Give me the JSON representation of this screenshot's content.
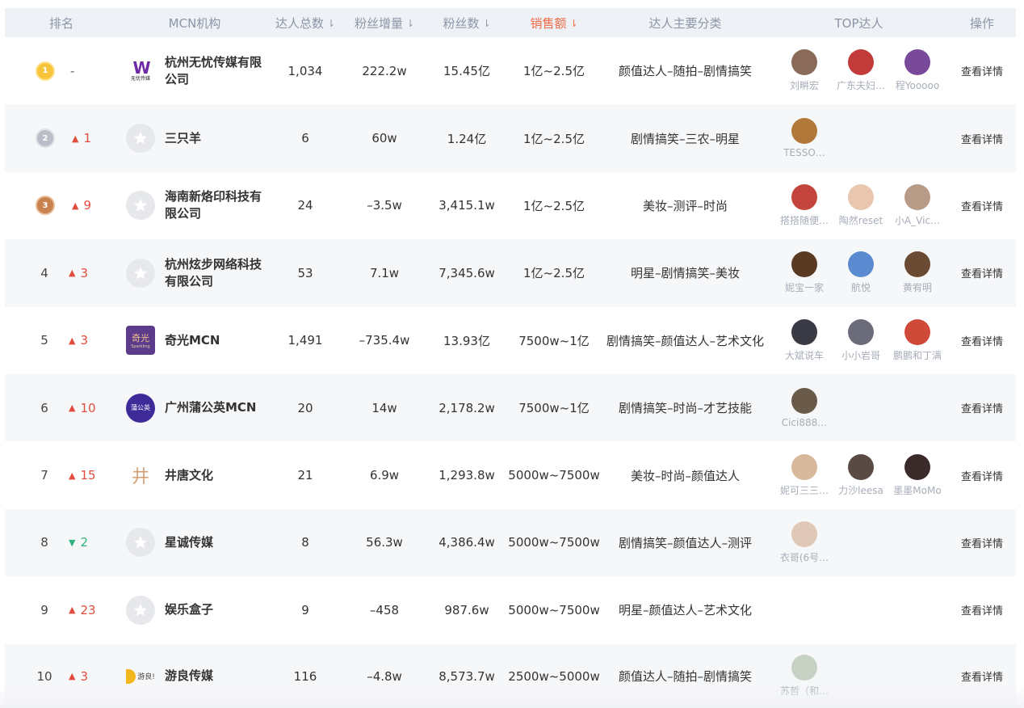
{
  "header": {
    "rank": "排名",
    "mcn": "MCN机构",
    "total": "达人总数",
    "fan_growth": "粉丝增量",
    "fans": "粉丝数",
    "sales": "销售额",
    "category": "达人主要分类",
    "top": "TOP达人",
    "op": "操作",
    "sort_icon": "sort-down-icon"
  },
  "colors": {
    "sales_header": "#ef6a45",
    "up": "#e24c3f",
    "down": "#34b27d",
    "header_bg": "#eef1f5",
    "alt_row_bg": "#f6f7f9"
  },
  "rows": [
    {
      "rank": "1",
      "change": "-",
      "dir": "none",
      "mcn": "杭州无忧传媒有限公司",
      "logo_text": "W",
      "logo_sub": "无忧传媒",
      "total": "1,034",
      "fan_growth": "222.2w",
      "fans": "15.45亿",
      "sales": "1亿~2.5亿",
      "category": "颜值达人–随拍–剧情搞笑",
      "top": [
        {
          "name": "刘畊宏",
          "color": "#8a6b5a"
        },
        {
          "name": "广东夫妇…",
          "color": "#c23a3a"
        },
        {
          "name": "程Yooooo",
          "color": "#7a4a9a"
        }
      ],
      "op": "查看详情"
    },
    {
      "rank": "2",
      "change": "1",
      "dir": "up",
      "mcn": "三只羊",
      "total": "6",
      "fan_growth": "60w",
      "fans": "1.24亿",
      "sales": "1亿~2.5亿",
      "category": "剧情搞笑–三农–明星",
      "top": [
        {
          "name": "TESSO…",
          "color": "#b0793a"
        }
      ],
      "op": "查看详情"
    },
    {
      "rank": "3",
      "change": "9",
      "dir": "up",
      "mcn": "海南新烙印科技有限公司",
      "total": "24",
      "fan_growth": "–3.5w",
      "fans": "3,415.1w",
      "sales": "1亿~2.5亿",
      "category": "美妆–测评–时尚",
      "top": [
        {
          "name": "搭搭随便…",
          "color": "#c4453e"
        },
        {
          "name": "陶然reset",
          "color": "#e8c6b0"
        },
        {
          "name": "小A_Vic…",
          "color": "#b79b86"
        }
      ],
      "op": "查看详情"
    },
    {
      "rank": "4",
      "change": "3",
      "dir": "up",
      "mcn": "杭州炫步网络科技有限公司",
      "total": "53",
      "fan_growth": "7.1w",
      "fans": "7,345.6w",
      "sales": "1亿~2.5亿",
      "category": "明星–剧情搞笑–美妆",
      "top": [
        {
          "name": "妮宝一家",
          "color": "#5a3a22"
        },
        {
          "name": "航悦",
          "color": "#5a8ad0"
        },
        {
          "name": "黄宥明",
          "color": "#6b4a33"
        }
      ],
      "op": "查看详情"
    },
    {
      "rank": "5",
      "change": "3",
      "dir": "up",
      "mcn": "奇光MCN",
      "logo_text": "奇光",
      "logo_sub": "Sparkling",
      "total": "1,491",
      "fan_growth": "–735.4w",
      "fans": "13.93亿",
      "sales": "7500w~1亿",
      "category": "剧情搞笑–颜值达人–艺术文化",
      "top": [
        {
          "name": "大斌说车",
          "color": "#3a3a44"
        },
        {
          "name": "小小岩哥",
          "color": "#6b6b7a"
        },
        {
          "name": "鹏鹏和丁满",
          "color": "#d04a3a"
        }
      ],
      "op": "查看详情"
    },
    {
      "rank": "6",
      "change": "10",
      "dir": "up",
      "mcn": "广州蒲公英MCN",
      "logo_text": "蒲公英",
      "total": "20",
      "fan_growth": "14w",
      "fans": "2,178.2w",
      "sales": "7500w~1亿",
      "category": "剧情搞笑–时尚–才艺技能",
      "top": [
        {
          "name": "Cici888…",
          "color": "#6a5a4a"
        }
      ],
      "op": "查看详情"
    },
    {
      "rank": "7",
      "change": "15",
      "dir": "up",
      "mcn": "井唐文化",
      "logo_text": "井",
      "total": "21",
      "fan_growth": "6.9w",
      "fans": "1,293.8w",
      "sales": "5000w~7500w",
      "category": "美妆–时尚–颜值达人",
      "top": [
        {
          "name": "妮可三三…",
          "color": "#d8b89a"
        },
        {
          "name": "力沙leesa",
          "color": "#5a4a44"
        },
        {
          "name": "墨墨MoMo",
          "color": "#3a2a2a"
        }
      ],
      "op": "查看详情"
    },
    {
      "rank": "8",
      "change": "2",
      "dir": "down",
      "mcn": "星诚传媒",
      "total": "8",
      "fan_growth": "56.3w",
      "fans": "4,386.4w",
      "sales": "5000w~7500w",
      "category": "剧情搞笑–颜值达人–测评",
      "top": [
        {
          "name": "衣哥(6号…",
          "color": "#e0c8b8"
        }
      ],
      "op": "查看详情"
    },
    {
      "rank": "9",
      "change": "23",
      "dir": "up",
      "mcn": "娱乐盒子",
      "total": "9",
      "fan_growth": "–458",
      "fans": "987.6w",
      "sales": "5000w~7500w",
      "category": "明星–颜值达人–艺术文化",
      "top": [],
      "op": "查看详情"
    },
    {
      "rank": "10",
      "change": "3",
      "dir": "up",
      "mcn": "游良传媒",
      "logo_text": "游良!",
      "total": "116",
      "fan_growth": "–4.8w",
      "fans": "8,573.7w",
      "sales": "2500w~5000w",
      "category": "颜值达人–随拍–剧情搞笑",
      "top": [
        {
          "name": "苏哲（和…",
          "color": "#c8d2c4"
        }
      ],
      "op": "查看详情"
    }
  ]
}
